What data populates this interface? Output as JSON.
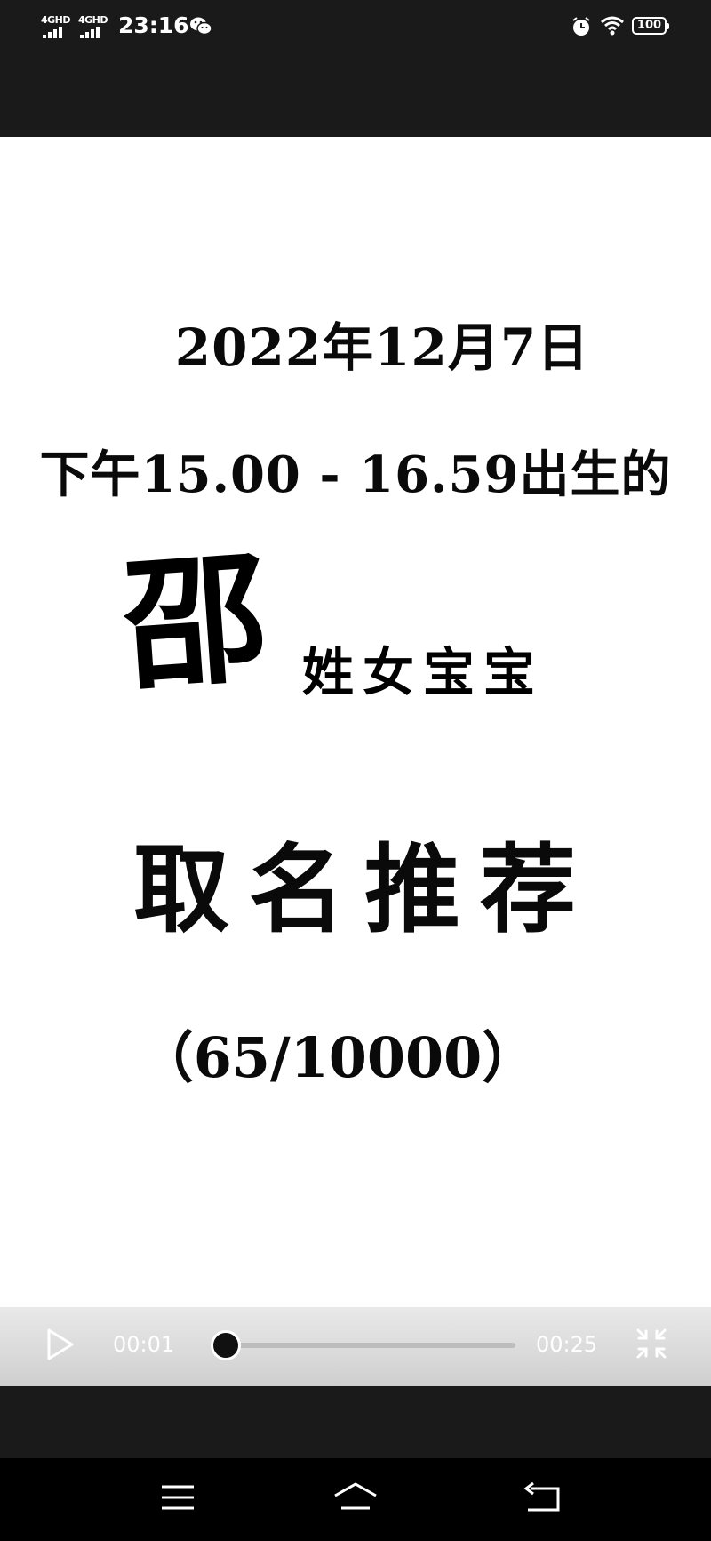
{
  "status_bar": {
    "signal_1": "4GHD",
    "signal_2": "4GHD",
    "time": "23:16",
    "battery": "100",
    "icons": [
      "wechat-icon",
      "alarm-icon",
      "wifi-icon",
      "battery-icon"
    ]
  },
  "video_content": {
    "line1": "2022年12月7日",
    "line2": "下午15.00 - 16.59出生的",
    "surname": "邵",
    "surname_suffix": "姓女宝宝",
    "line4": "取名推荐",
    "line5": "（65/10000）"
  },
  "player": {
    "current_time": "00:01",
    "total_time": "00:25",
    "progress": 0.04,
    "played_color": "#e33333",
    "icons": [
      "play-icon",
      "exit-fullscreen-icon"
    ]
  },
  "nav_bar": {
    "icons": [
      "menu-icon",
      "home-icon",
      "back-icon"
    ]
  }
}
